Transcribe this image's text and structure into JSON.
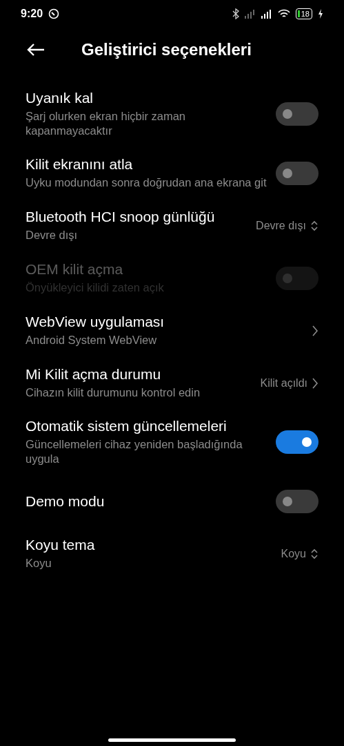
{
  "status_bar": {
    "time": "9:20",
    "battery": "18"
  },
  "header": {
    "title": "Geliştirici seçenekleri"
  },
  "settings": [
    {
      "kind": "toggle",
      "title": "Uyanık kal",
      "subtitle": "Şarj olurken ekran hiçbir zaman kapanmayacaktır",
      "on": false,
      "disabled": false
    },
    {
      "kind": "toggle",
      "title": "Kilit ekranını atla",
      "subtitle": "Uyku modundan sonra doğrudan ana ekrana git",
      "on": false,
      "disabled": false
    },
    {
      "kind": "select",
      "title": "Bluetooth HCI snoop günlüğü",
      "subtitle": "Devre dışı",
      "value": "Devre dışı",
      "disabled": false
    },
    {
      "kind": "toggle",
      "title": "OEM kilit açma",
      "subtitle": "Önyükleyici kilidi zaten açık",
      "on": false,
      "disabled": true
    },
    {
      "kind": "link",
      "title": "WebView uygulaması",
      "subtitle": "Android System WebView",
      "disabled": false
    },
    {
      "kind": "link",
      "title": "Mi Kilit açma durumu",
      "subtitle": "Cihazın kilit durumunu kontrol edin",
      "value": "Kilit açıldı",
      "disabled": false
    },
    {
      "kind": "toggle",
      "title": "Otomatik sistem güncellemeleri",
      "subtitle": "Güncellemeleri cihaz yeniden başladığında uygula",
      "on": true,
      "disabled": false
    },
    {
      "kind": "toggle",
      "title": "Demo modu",
      "on": false,
      "disabled": false
    },
    {
      "kind": "select",
      "title": "Koyu tema",
      "subtitle": "Koyu",
      "value": "Koyu",
      "disabled": false
    }
  ]
}
